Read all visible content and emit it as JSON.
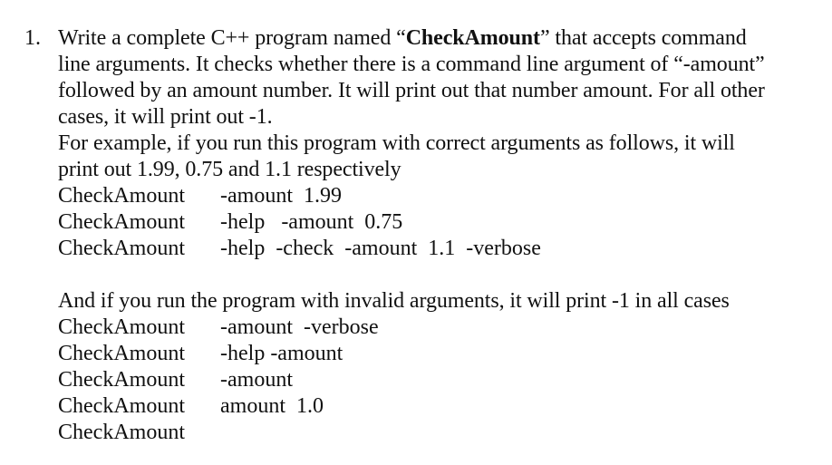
{
  "question": {
    "number": "1.",
    "intro": {
      "line1_before": "Write a complete C++ program named “",
      "program_name": "CheckAmount",
      "line1_after": "” that accepts command",
      "line2": "line arguments. It checks whether there is a command line argument of “-amount”",
      "line3": "followed by an amount number. It will print out that number amount. For all other",
      "line4": "cases, it will print out -1."
    },
    "example_intro": {
      "line1": "For example, if you run this program with correct arguments as follows, it will",
      "line2": "print out 1.99, 0.75 and 1.1 respectively"
    },
    "valid_examples": [
      {
        "program": "CheckAmount",
        "args": "-amount  1.99"
      },
      {
        "program": "CheckAmount",
        "args": "-help   -amount  0.75"
      },
      {
        "program": "CheckAmount",
        "args": "-help  -check  -amount  1.1  -verbose"
      }
    ],
    "invalid_intro": "And if you run the program with invalid arguments, it will print -1 in all cases",
    "invalid_examples": [
      {
        "program": "CheckAmount",
        "args": "-amount  -verbose"
      },
      {
        "program": "CheckAmount",
        "args": "-help -amount"
      },
      {
        "program": "CheckAmount",
        "args": "-amount"
      },
      {
        "program": "CheckAmount",
        "args": "amount  1.0"
      },
      {
        "program": "CheckAmount",
        "args": ""
      }
    ]
  }
}
